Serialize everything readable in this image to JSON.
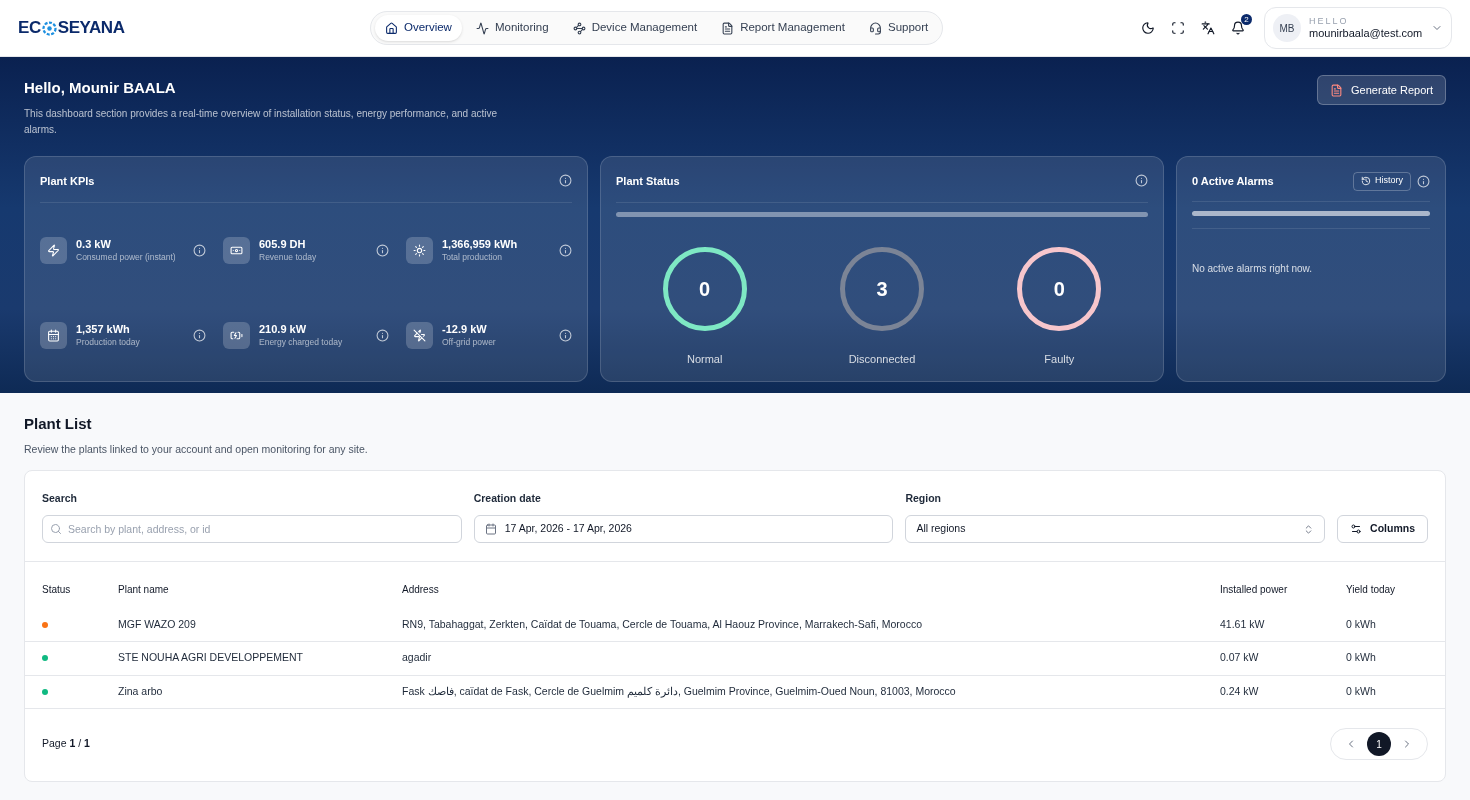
{
  "logo": {
    "before": "EC",
    "after": "SEYANA"
  },
  "nav": [
    {
      "label": "Overview",
      "selected": true
    },
    {
      "label": "Monitoring",
      "selected": false
    },
    {
      "label": "Device Management",
      "selected": false
    },
    {
      "label": "Report Management",
      "selected": false
    },
    {
      "label": "Support",
      "selected": false
    }
  ],
  "notifications": "2",
  "user": {
    "initials": "MB",
    "greeting": "HELLO",
    "email": "mounirbaala@test.com"
  },
  "hero": {
    "title": "Hello, Mounir BAALA",
    "subtitle": "This dashboard section provides a real-time overview of installation status, energy performance, and active alarms.",
    "button": "Generate Report"
  },
  "kpis": {
    "title": "Plant KPIs",
    "items": [
      {
        "value": "0.3 kW",
        "label": "Consumed power (instant)"
      },
      {
        "value": "605.9 DH",
        "label": "Revenue today"
      },
      {
        "value": "1,366,959 kWh",
        "label": "Total production"
      },
      {
        "value": "1,357 kWh",
        "label": "Production today"
      },
      {
        "value": "210.9 kW",
        "label": "Energy charged today"
      },
      {
        "value": "-12.9 kW",
        "label": "Off-grid power"
      }
    ]
  },
  "plant_status": {
    "title": "Plant Status",
    "items": [
      {
        "count": "0",
        "label": "Normal",
        "color": "#7ee8c4"
      },
      {
        "count": "3",
        "label": "Disconnected",
        "color": "#7b8496"
      },
      {
        "count": "0",
        "label": "Faulty",
        "color": "#f7c6cc"
      }
    ]
  },
  "alarms": {
    "title": "0 Active Alarms",
    "history": "History",
    "message": "No active alarms right now."
  },
  "plant_list": {
    "title": "Plant List",
    "subtitle": "Review the plants linked to your account and open monitoring for any site.",
    "filters": {
      "search_label": "Search",
      "search_placeholder": "Search by plant, address, or id",
      "date_label": "Creation date",
      "date_value": "17 Apr, 2026 - 17 Apr, 2026",
      "region_label": "Region",
      "region_value": "All regions",
      "columns_button": "Columns"
    },
    "columns": [
      "Status",
      "Plant name",
      "Address",
      "Installed power",
      "Yield today"
    ],
    "rows": [
      {
        "color": "#f97316",
        "name": "MGF WAZO 209",
        "address": "RN9, Tabahaggat, Zerkten, Caïdat de Touama, Cercle de Touama, Al Haouz Province, Marrakech-Safi, Morocco",
        "power": "41.61 kW",
        "yield": "0 kWh"
      },
      {
        "color": "#10b981",
        "name": "STE NOUHA AGRI DEVELOPPEMENT",
        "address": "agadir",
        "power": "0.07 kW",
        "yield": "0 kWh"
      },
      {
        "color": "#10b981",
        "name": "Zina arbo",
        "address": "Fask فاصك, caïdat de Fask, Cercle de Guelmim دائرة كلميم, Guelmim Province, Guelmim-Oued Noun, 81003, Morocco",
        "power": "0.24 kW",
        "yield": "0 kWh"
      }
    ],
    "page_text": "Page **1** / **1**",
    "pages": [
      {
        "label": "1",
        "selected": true
      }
    ]
  }
}
